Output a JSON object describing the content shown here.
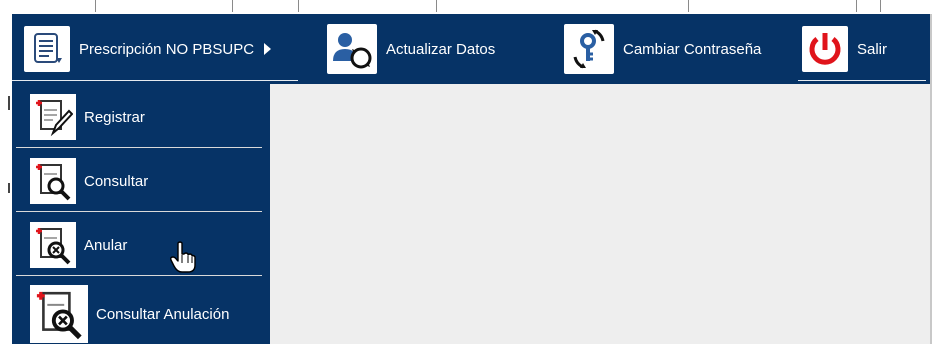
{
  "topbar": {
    "items": [
      {
        "label": "Prescripción NO PBSUPC",
        "icon": "prescription-document-icon"
      },
      {
        "label": "Actualizar Datos",
        "icon": "user-refresh-icon"
      },
      {
        "label": "Cambiar Contraseña",
        "icon": "key-refresh-icon"
      },
      {
        "label": "Salir",
        "icon": "power-icon"
      }
    ]
  },
  "dropdown": {
    "items": [
      {
        "label": "Registrar",
        "icon": "document-pencil-icon"
      },
      {
        "label": "Consultar",
        "icon": "document-search-icon"
      },
      {
        "label": "Anular",
        "icon": "document-cancel-search-icon"
      },
      {
        "label": "Consultar Anulación",
        "icon": "document-cancel-search-icon"
      }
    ]
  },
  "colors": {
    "nav_background": "#063366",
    "nav_text": "#ffffff",
    "content_background": "#eeeeee",
    "accent_red": "#e0141b"
  },
  "cursor": {
    "type": "hand-pointer-icon"
  }
}
